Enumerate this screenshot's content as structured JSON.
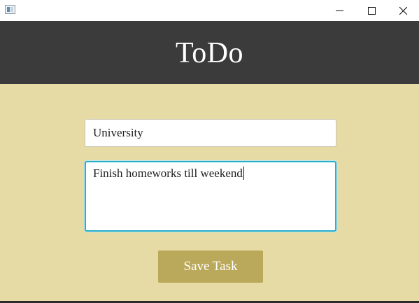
{
  "window": {
    "controls": {
      "minimize_icon": "minimize-icon",
      "maximize_icon": "maximize-icon",
      "close_icon": "close-icon"
    }
  },
  "header": {
    "title": "ToDo",
    "background": "#3b3b3b"
  },
  "form": {
    "title_input": {
      "value": "University"
    },
    "description_input": {
      "value": "Finish homeworks till weekend",
      "focused": true
    },
    "save_label": "Save Task"
  },
  "colors": {
    "content_background": "#e6dba5",
    "button_background": "#bba95b",
    "focus_border": "#2ab0c8"
  }
}
